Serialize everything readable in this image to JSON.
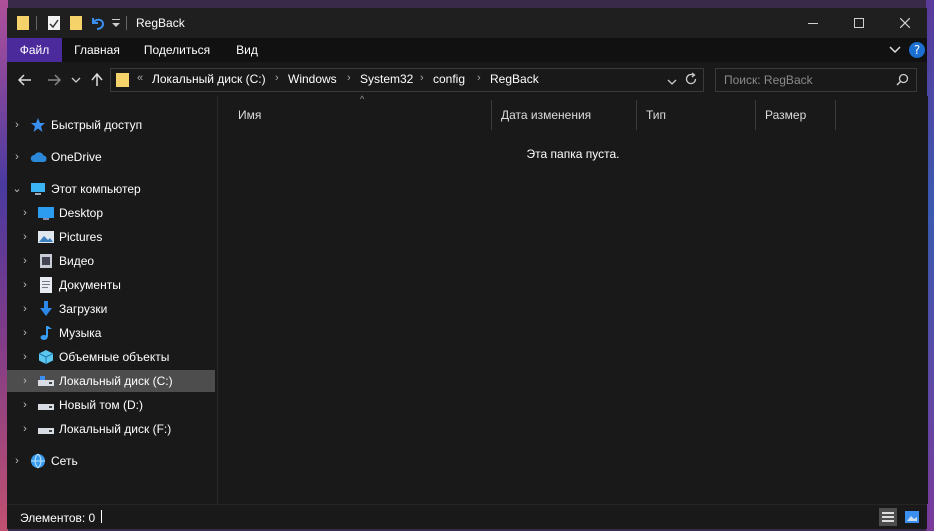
{
  "window": {
    "title": "RegBack"
  },
  "ribbon": {
    "tabs": [
      "Файл",
      "Главная",
      "Поделиться",
      "Вид"
    ]
  },
  "address": {
    "path": [
      "Локальный диск (C:)",
      "Windows",
      "System32",
      "config",
      "RegBack"
    ]
  },
  "search": {
    "placeholder": "Поиск: RegBack"
  },
  "sidebar": {
    "items": [
      {
        "label": "Быстрый доступ",
        "icon": "star-icon"
      },
      {
        "label": "OneDrive",
        "icon": "cloud-icon"
      },
      {
        "label": "Этот компьютер",
        "icon": "computer-icon"
      },
      {
        "label": "Desktop",
        "icon": "desktop-icon"
      },
      {
        "label": "Pictures",
        "icon": "pictures-icon"
      },
      {
        "label": "Видео",
        "icon": "video-icon"
      },
      {
        "label": "Документы",
        "icon": "document-icon"
      },
      {
        "label": "Загрузки",
        "icon": "download-icon"
      },
      {
        "label": "Музыка",
        "icon": "music-icon"
      },
      {
        "label": "Объемные объекты",
        "icon": "3d-objects-icon"
      },
      {
        "label": "Локальный диск (C:)",
        "icon": "drive-icon",
        "selected": true
      },
      {
        "label": "Новый том (D:)",
        "icon": "drive-icon"
      },
      {
        "label": "Локальный диск (F:)",
        "icon": "drive-icon"
      },
      {
        "label": "Сеть",
        "icon": "network-icon"
      }
    ]
  },
  "columns": [
    "Имя",
    "Дата изменения",
    "Тип",
    "Размер"
  ],
  "content": {
    "empty_message": "Эта папка пуста."
  },
  "status": {
    "text": "Элементов: 0"
  },
  "colors": {
    "accent": "#4b2a9c",
    "background": "#191919",
    "selected": "#4d4d4d"
  }
}
